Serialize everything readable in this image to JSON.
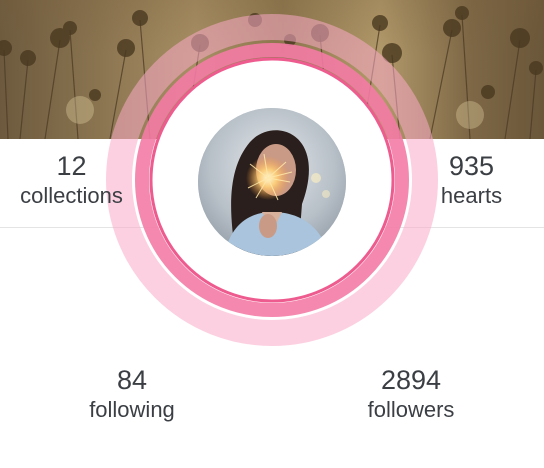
{
  "profile": {
    "avatar_icon": "profile-photo",
    "stats": {
      "collections": {
        "value": "12",
        "label": "collections"
      },
      "hearts": {
        "value": "935",
        "label": "hearts"
      },
      "following": {
        "value": "84",
        "label": "following"
      },
      "followers": {
        "value": "2894",
        "label": "followers"
      }
    }
  },
  "colors": {
    "ring_outer": "#fbc6d8",
    "ring_mid": "#f688ad",
    "ring_inner": "#f06595"
  }
}
